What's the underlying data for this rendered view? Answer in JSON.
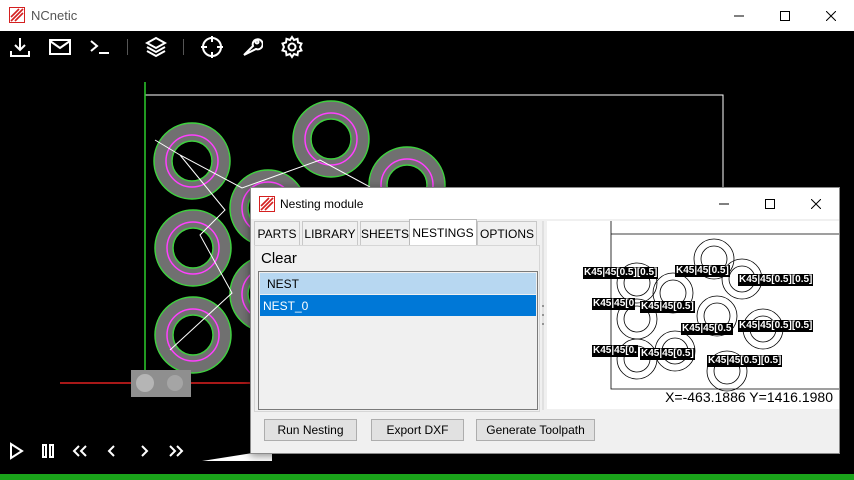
{
  "app": {
    "title": "NCnetic"
  },
  "toolbar": {
    "icons": [
      "download-icon",
      "mail-icon",
      "terminal-icon",
      "layers-icon",
      "crosshair-icon",
      "wrench-icon",
      "gear-icon"
    ]
  },
  "player": {
    "icons": [
      "play-icon",
      "pause-icon",
      "rewind-icon",
      "step-back-icon",
      "step-forward-icon",
      "fast-forward-icon"
    ]
  },
  "dialog": {
    "title": "Nesting module",
    "tabs": [
      "PARTS",
      "LIBRARY",
      "SHEETS",
      "NESTINGS",
      "OPTIONS"
    ],
    "active_tab": "NESTINGS",
    "clear_label": "Clear",
    "list": {
      "header": "NEST",
      "items": [
        "NEST_0"
      ],
      "selected": "NEST_0"
    },
    "preview": {
      "part_labels": [
        "K45|45[0.5][0.5]",
        "K45|45[0.5]",
        "K45|45[0.5][0.5]",
        "K45|45[0",
        "K45|45[0.5]",
        "K45|45[0.5",
        "K45|45[0.5][0.5]",
        "K45|45[0.",
        "K45|45[0.5]",
        "K45|45[0.5][0.5]"
      ],
      "coordinates": "X=-463.1886 Y=1416.1980"
    },
    "buttons": {
      "run": "Run Nesting",
      "export": "Export DXF",
      "toolpath": "Generate Toolpath"
    }
  },
  "colors": {
    "ring_green": "#3fd13f",
    "ring_magenta": "#ff40ff",
    "status_green": "#1aa31a",
    "selection_blue": "#0078d7"
  }
}
